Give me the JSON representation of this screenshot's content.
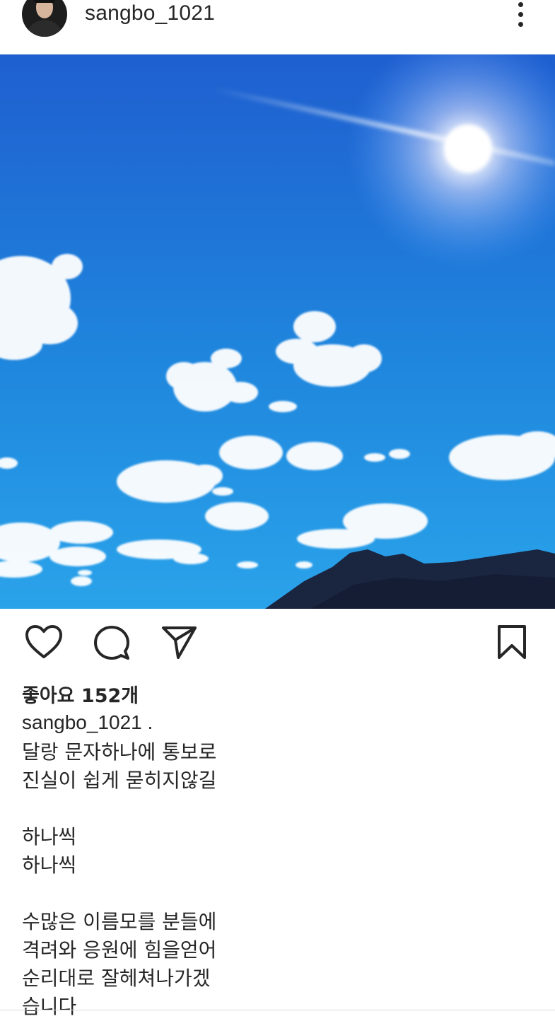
{
  "post": {
    "username": "sangbo_1021",
    "likes": "좋아요 152개",
    "caption_author": "sangbo_1021 .",
    "caption_text": "달랑 문자하나에 통보로\n진실이 쉽게 묻히지않길\n\n하나씩\n하나씩\n\n수많은 이름모를 분들에\n격려와 응원에 힘을얻어\n순리대로 잘헤쳐나가겠\n습니다"
  },
  "icons": {
    "avatar": "avatar",
    "more": "more-vertical-icon",
    "like": "heart-icon",
    "comment": "comment-icon",
    "share": "send-icon",
    "save": "bookmark-icon"
  },
  "colors": {
    "sky_top": "#1f5fd0",
    "sky_bottom": "#2aa3ea",
    "mountain": "#1a2540",
    "text": "#262626"
  }
}
